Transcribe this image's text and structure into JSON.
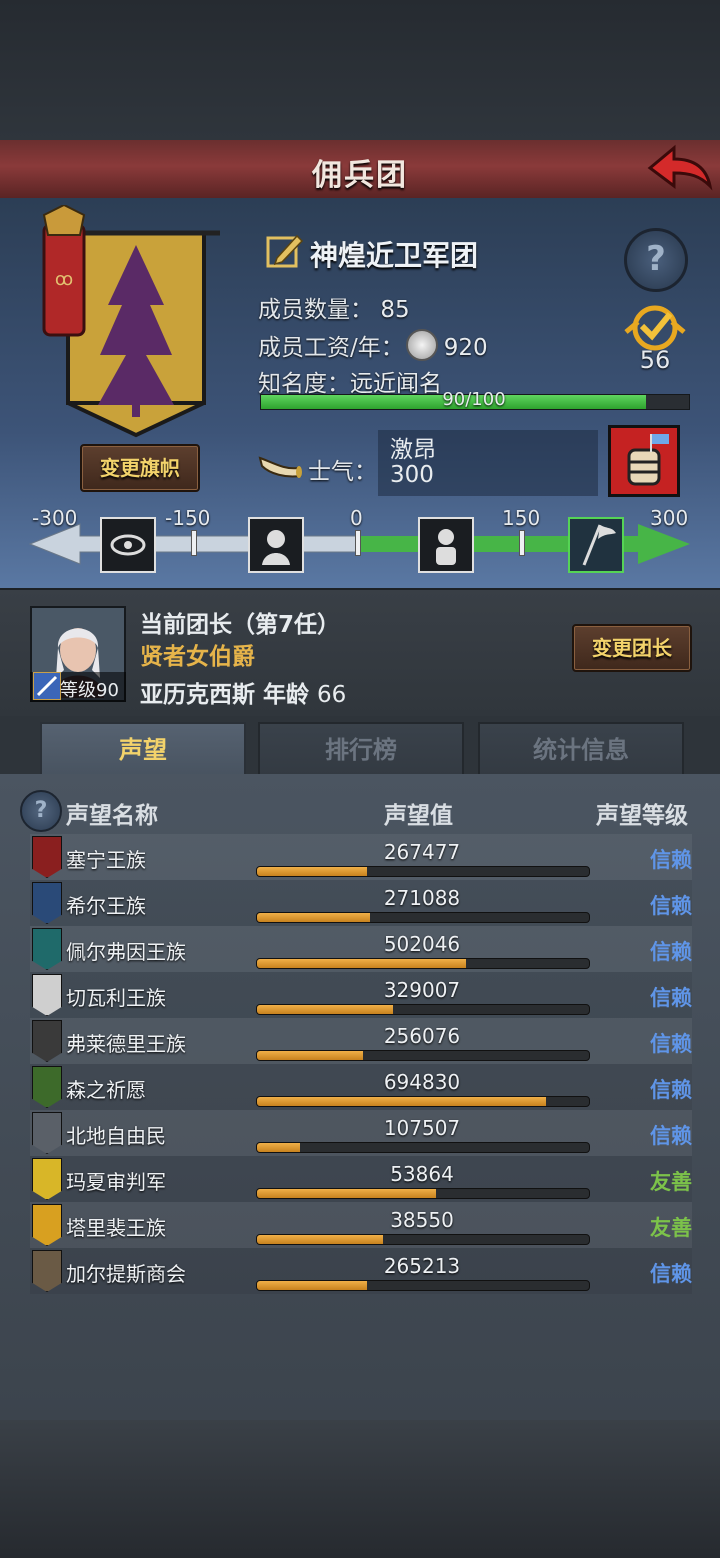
{
  "header": {
    "title": "佣兵团",
    "back_icon": "back-arrow-icon"
  },
  "team": {
    "name": "神煌近卫军团",
    "members_label": "成员数量：",
    "members_value": "85",
    "salary_label": "成员工资/年：",
    "salary_value": "920",
    "fame_label": "知名度：",
    "fame_value": "远近闻名",
    "fame_progress_text": "90/100",
    "fame_progress": 0.9,
    "rank": "56",
    "change_banner_label": "变更旗帜"
  },
  "morale": {
    "label": "士气：",
    "state": "激昂",
    "value": "300",
    "scale_labels": [
      "-300",
      "-150",
      "0",
      "150",
      "300"
    ],
    "level": 300
  },
  "leader": {
    "title_line": "当前团长（第7任）",
    "rank_title": "贤者女伯爵",
    "name": "亚历克西斯",
    "age_label": "年龄",
    "age": "66",
    "level_text": "等级90",
    "change_label": "变更团长"
  },
  "tabs": [
    {
      "label": "声望",
      "active": true
    },
    {
      "label": "排行榜",
      "active": false
    },
    {
      "label": "统计信息",
      "active": false
    }
  ],
  "table": {
    "col_name": "声望名称",
    "col_value": "声望值",
    "col_level": "声望等级",
    "rows": [
      {
        "name": "塞宁王族",
        "value": "267477",
        "fill": 0.33,
        "level": "信赖",
        "level_color": "#5f95e8",
        "crest_color": "#8a1f1f"
      },
      {
        "name": "希尔王族",
        "value": "271088",
        "fill": 0.34,
        "level": "信赖",
        "level_color": "#5f95e8",
        "crest_color": "#2a4a78"
      },
      {
        "name": "佩尔弗因王族",
        "value": "502046",
        "fill": 0.63,
        "level": "信赖",
        "level_color": "#5f95e8",
        "crest_color": "#1f6a6a"
      },
      {
        "name": "切瓦利王族",
        "value": "329007",
        "fill": 0.41,
        "level": "信赖",
        "level_color": "#5f95e8",
        "crest_color": "#cfcfcf"
      },
      {
        "name": "弗莱德里王族",
        "value": "256076",
        "fill": 0.32,
        "level": "信赖",
        "level_color": "#5f95e8",
        "crest_color": "#3a3a3a"
      },
      {
        "name": "森之祈愿",
        "value": "694830",
        "fill": 0.87,
        "level": "信赖",
        "level_color": "#5f95e8",
        "crest_color": "#3d6a2a"
      },
      {
        "name": "北地自由民",
        "value": "107507",
        "fill": 0.13,
        "level": "信赖",
        "level_color": "#5f95e8",
        "crest_color": "#5a6068"
      },
      {
        "name": "玛夏审判军",
        "value": "53864",
        "fill": 0.54,
        "level": "友善",
        "level_color": "#7cc24a",
        "crest_color": "#d8b628"
      },
      {
        "name": "塔里裴王族",
        "value": "38550",
        "fill": 0.38,
        "level": "友善",
        "level_color": "#7cc24a",
        "crest_color": "#d8a020"
      },
      {
        "name": "加尔提斯商会",
        "value": "265213",
        "fill": 0.33,
        "level": "信赖",
        "level_color": "#5f95e8",
        "crest_color": "#6a5a45"
      }
    ]
  }
}
